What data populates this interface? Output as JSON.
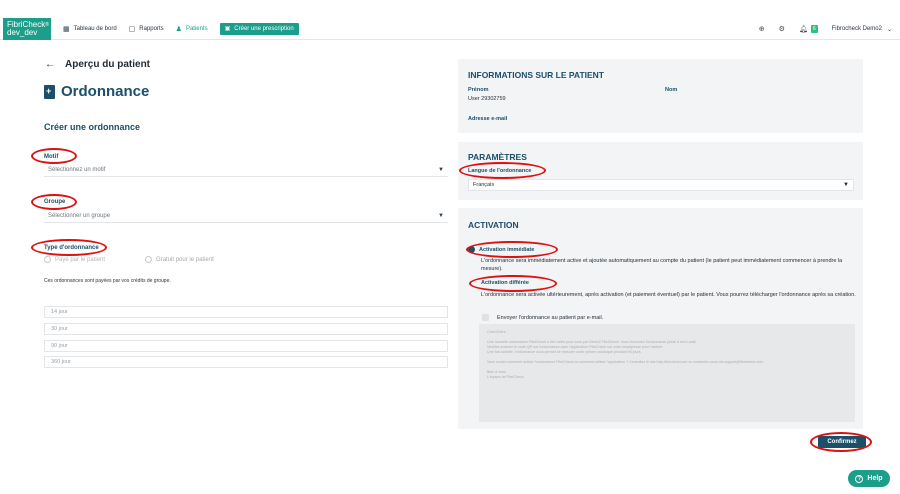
{
  "nav": {
    "logo_line1": "FibriCheck",
    "logo_sup": "®",
    "logo_line2": "dev_dev",
    "items": [
      {
        "icon": "dashboard-icon",
        "label": "Tableau de bord"
      },
      {
        "icon": "reports-icon",
        "label": "Rapports"
      },
      {
        "icon": "patients-icon",
        "label": "Patients"
      }
    ],
    "create_button": "Créer une prescription",
    "notification_count": "6",
    "user": "Fibrocheck Demo2"
  },
  "page": {
    "back_label": "Aperçu du patient",
    "title": "Ordonnance",
    "section_title": "Créer une ordonnance"
  },
  "form": {
    "motif_label": "Motif",
    "motif_placeholder": "Sélectionnez un motif",
    "groupe_label": "Groupe",
    "groupe_placeholder": "Sélectionner un groupe",
    "type_label": "Type d'ordonnance",
    "type_option1": "Payé par le patient",
    "type_option2": "Gratuit pour le patient",
    "note": "Ces ordonnances sont payées par vos crédits de groupe.",
    "durations": [
      "14 jour",
      "30 jour",
      "90 jour",
      "360 jour"
    ]
  },
  "patient_panel": {
    "title": "INFORMATIONS SUR LE PATIENT",
    "prenom_label": "Prénom",
    "prenom_value": "User 29302759",
    "nom_label": "Nom",
    "email_label": "Adresse e-mail"
  },
  "params_panel": {
    "title": "PARAMÈTRES",
    "lang_label": "Langue de l'ordonnance",
    "lang_value": "Français"
  },
  "activation_panel": {
    "title": "ACTIVATION",
    "immediate_label": "Activation immédiate",
    "immediate_text": "L'ordonnance sera immédiatement active et ajoutée automatiquement au compte du patient (le patient peut immédiatement commencer à prendre la mesure).",
    "deferred_label": "Activation différée",
    "deferred_text": "L'ordonnance sera activée ultérieurement, après activation (et paiement éventuel) par le patient. Vous pourrez télécharger l'ordonnance après sa création.",
    "send_email_label": "Envoyer l'ordonnance au patient par e-mail.",
    "email_paragraphs": [
      "Cher/Chère ,",
      "Une nouvelle ordonnance FibriCheck a été créée pour vous par Demo2 FibriCheck. Vous trouverez l'ordonnance jointe à cet e-mail.\nVeuillez scanner le code QR sur l'ordonnance avec l'application FibriCheck sur votre smartphone pour l'activer.\nUne fois activée, l'ordonnance vous permet de mesurer votre rythme cardiaque pendant 90 jours.",
      "Vous voulez comment activer l'ordonnance FibriCheck ou comment utiliser l'application ? Consultez le site help.fibricheck.com ou contactez-nous via support@fibricheck.com.",
      "Bien à vous,\nL'équipe de FibriCheck"
    ]
  },
  "confirm_label": "Confirmez",
  "help_label": "Help"
}
